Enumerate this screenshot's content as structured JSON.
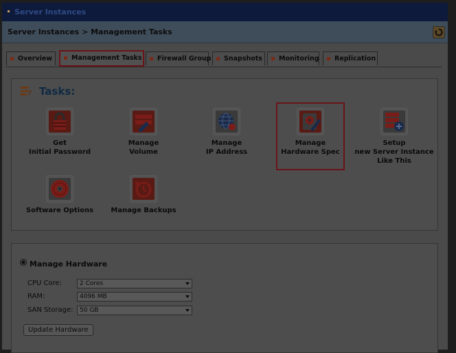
{
  "window": {
    "title": "Server Instances"
  },
  "breadcrumb": {
    "text": "Server Instances >  Management Tasks"
  },
  "tabs": [
    {
      "label": "Overview"
    },
    {
      "label": "Management Tasks",
      "active": true
    },
    {
      "label": "Firewall Group"
    },
    {
      "label": "Snapshots"
    },
    {
      "label": "Monitoring"
    },
    {
      "label": "Replication"
    }
  ],
  "tasks": {
    "heading": "Tasks:",
    "items": [
      {
        "line1": "Get",
        "line2": "Initial Password",
        "icon": "lock-icon"
      },
      {
        "line1": "Manage",
        "line2": "Volume",
        "icon": "volume-icon"
      },
      {
        "line1": "Manage",
        "line2": "IP Address",
        "icon": "globe-icon"
      },
      {
        "line1": "Manage",
        "line2": "Hardware Spec",
        "icon": "hardware-icon",
        "highlighted": true
      },
      {
        "line1": "Setup",
        "line2": "new Server Instance",
        "line3": "Like This",
        "icon": "server-add-icon"
      },
      {
        "line1": "Software Options",
        "icon": "disc-icon"
      },
      {
        "line1": "Manage Backups",
        "icon": "backup-icon"
      }
    ]
  },
  "hardware": {
    "title": "Manage Hardware",
    "fields": [
      {
        "label": "CPU Core:",
        "value": "2 Cores"
      },
      {
        "label": "RAM:",
        "value": "4096 MB"
      },
      {
        "label": "SAN Storage:",
        "value": "50 GB"
      }
    ],
    "update_button": "Update Hardware"
  },
  "colors": {
    "accent_red": "#6a1418",
    "title_bar": "#0e1a3b",
    "heading_blue": "#0f2a44"
  }
}
